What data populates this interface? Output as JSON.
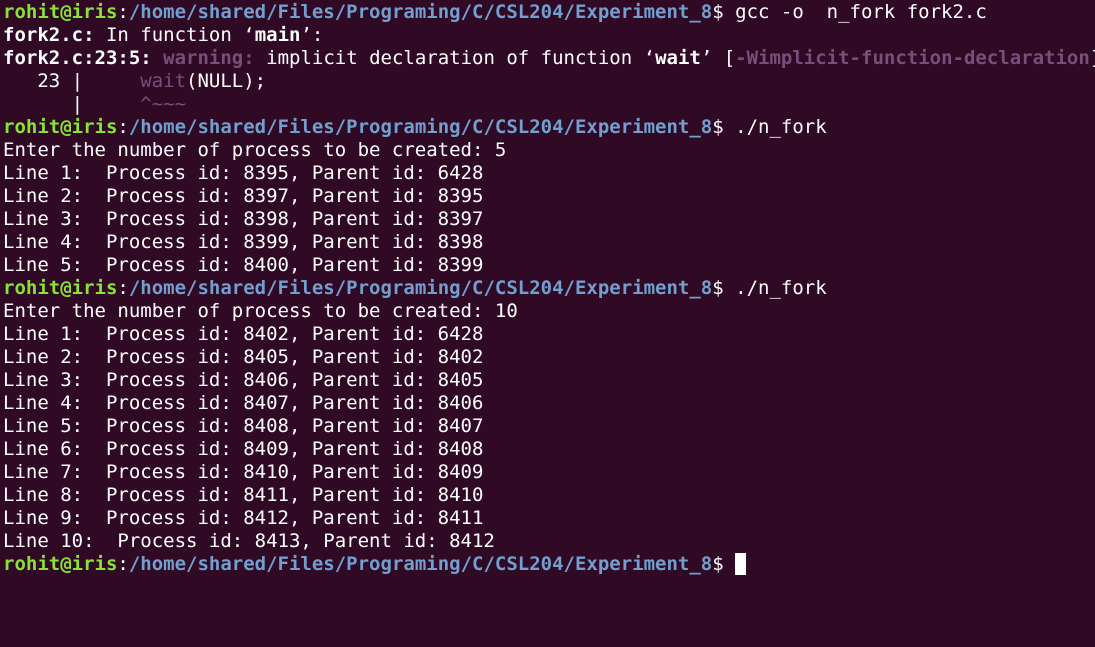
{
  "prompt": {
    "user_host": "rohit@iris",
    "colon": ":",
    "path": "/home/shared/Files/Programing/C/CSL204/Experiment_8",
    "symbol": "$ "
  },
  "commands": {
    "compile": "gcc -o  n_fork fork2.c",
    "run1": "./n_fork",
    "run2": "./n_fork"
  },
  "compiler": {
    "line1_file": "fork2.c:",
    "line1_text": " In function ",
    "line1_q1": "‘",
    "line1_func": "main",
    "line1_q2": "’:",
    "line2_loc": "fork2.c:23:5:",
    "line2_sp": " ",
    "line2_warn": "warning:",
    "line2_text": " implicit declaration of function ",
    "line2_q1": "‘",
    "line2_func": "wait",
    "line2_q2": "’ [",
    "line2_flag": "-Wimplicit-function-declaration",
    "line2_close": "]",
    "line3_gutter": "   23 |     ",
    "line3_code_hl": "wait",
    "line3_code_rest": "(NULL);",
    "line4_gutter": "      |     ",
    "line4_caret": "^~~~"
  },
  "run1": {
    "prompt_text": "Enter the number of process to be created: 5",
    "lines": [
      "Line 1:  Process id: 8395, Parent id: 6428",
      "Line 2:  Process id: 8397, Parent id: 8395",
      "Line 3:  Process id: 8398, Parent id: 8397",
      "Line 4:  Process id: 8399, Parent id: 8398",
      "Line 5:  Process id: 8400, Parent id: 8399"
    ]
  },
  "run2": {
    "prompt_text": "Enter the number of process to be created: 10",
    "lines": [
      "Line 1:  Process id: 8402, Parent id: 6428",
      "Line 2:  Process id: 8405, Parent id: 8402",
      "Line 3:  Process id: 8406, Parent id: 8405",
      "Line 4:  Process id: 8407, Parent id: 8406",
      "Line 5:  Process id: 8408, Parent id: 8407",
      "Line 6:  Process id: 8409, Parent id: 8408",
      "Line 7:  Process id: 8410, Parent id: 8409",
      "Line 8:  Process id: 8411, Parent id: 8410",
      "Line 9:  Process id: 8412, Parent id: 8411",
      "Line 10:  Process id: 8413, Parent id: 8412"
    ]
  },
  "colors": {
    "background": "#300a24",
    "text": "#ffffff",
    "user_host": "#8ae234",
    "path": "#729fcf",
    "warning": "#75507b"
  }
}
